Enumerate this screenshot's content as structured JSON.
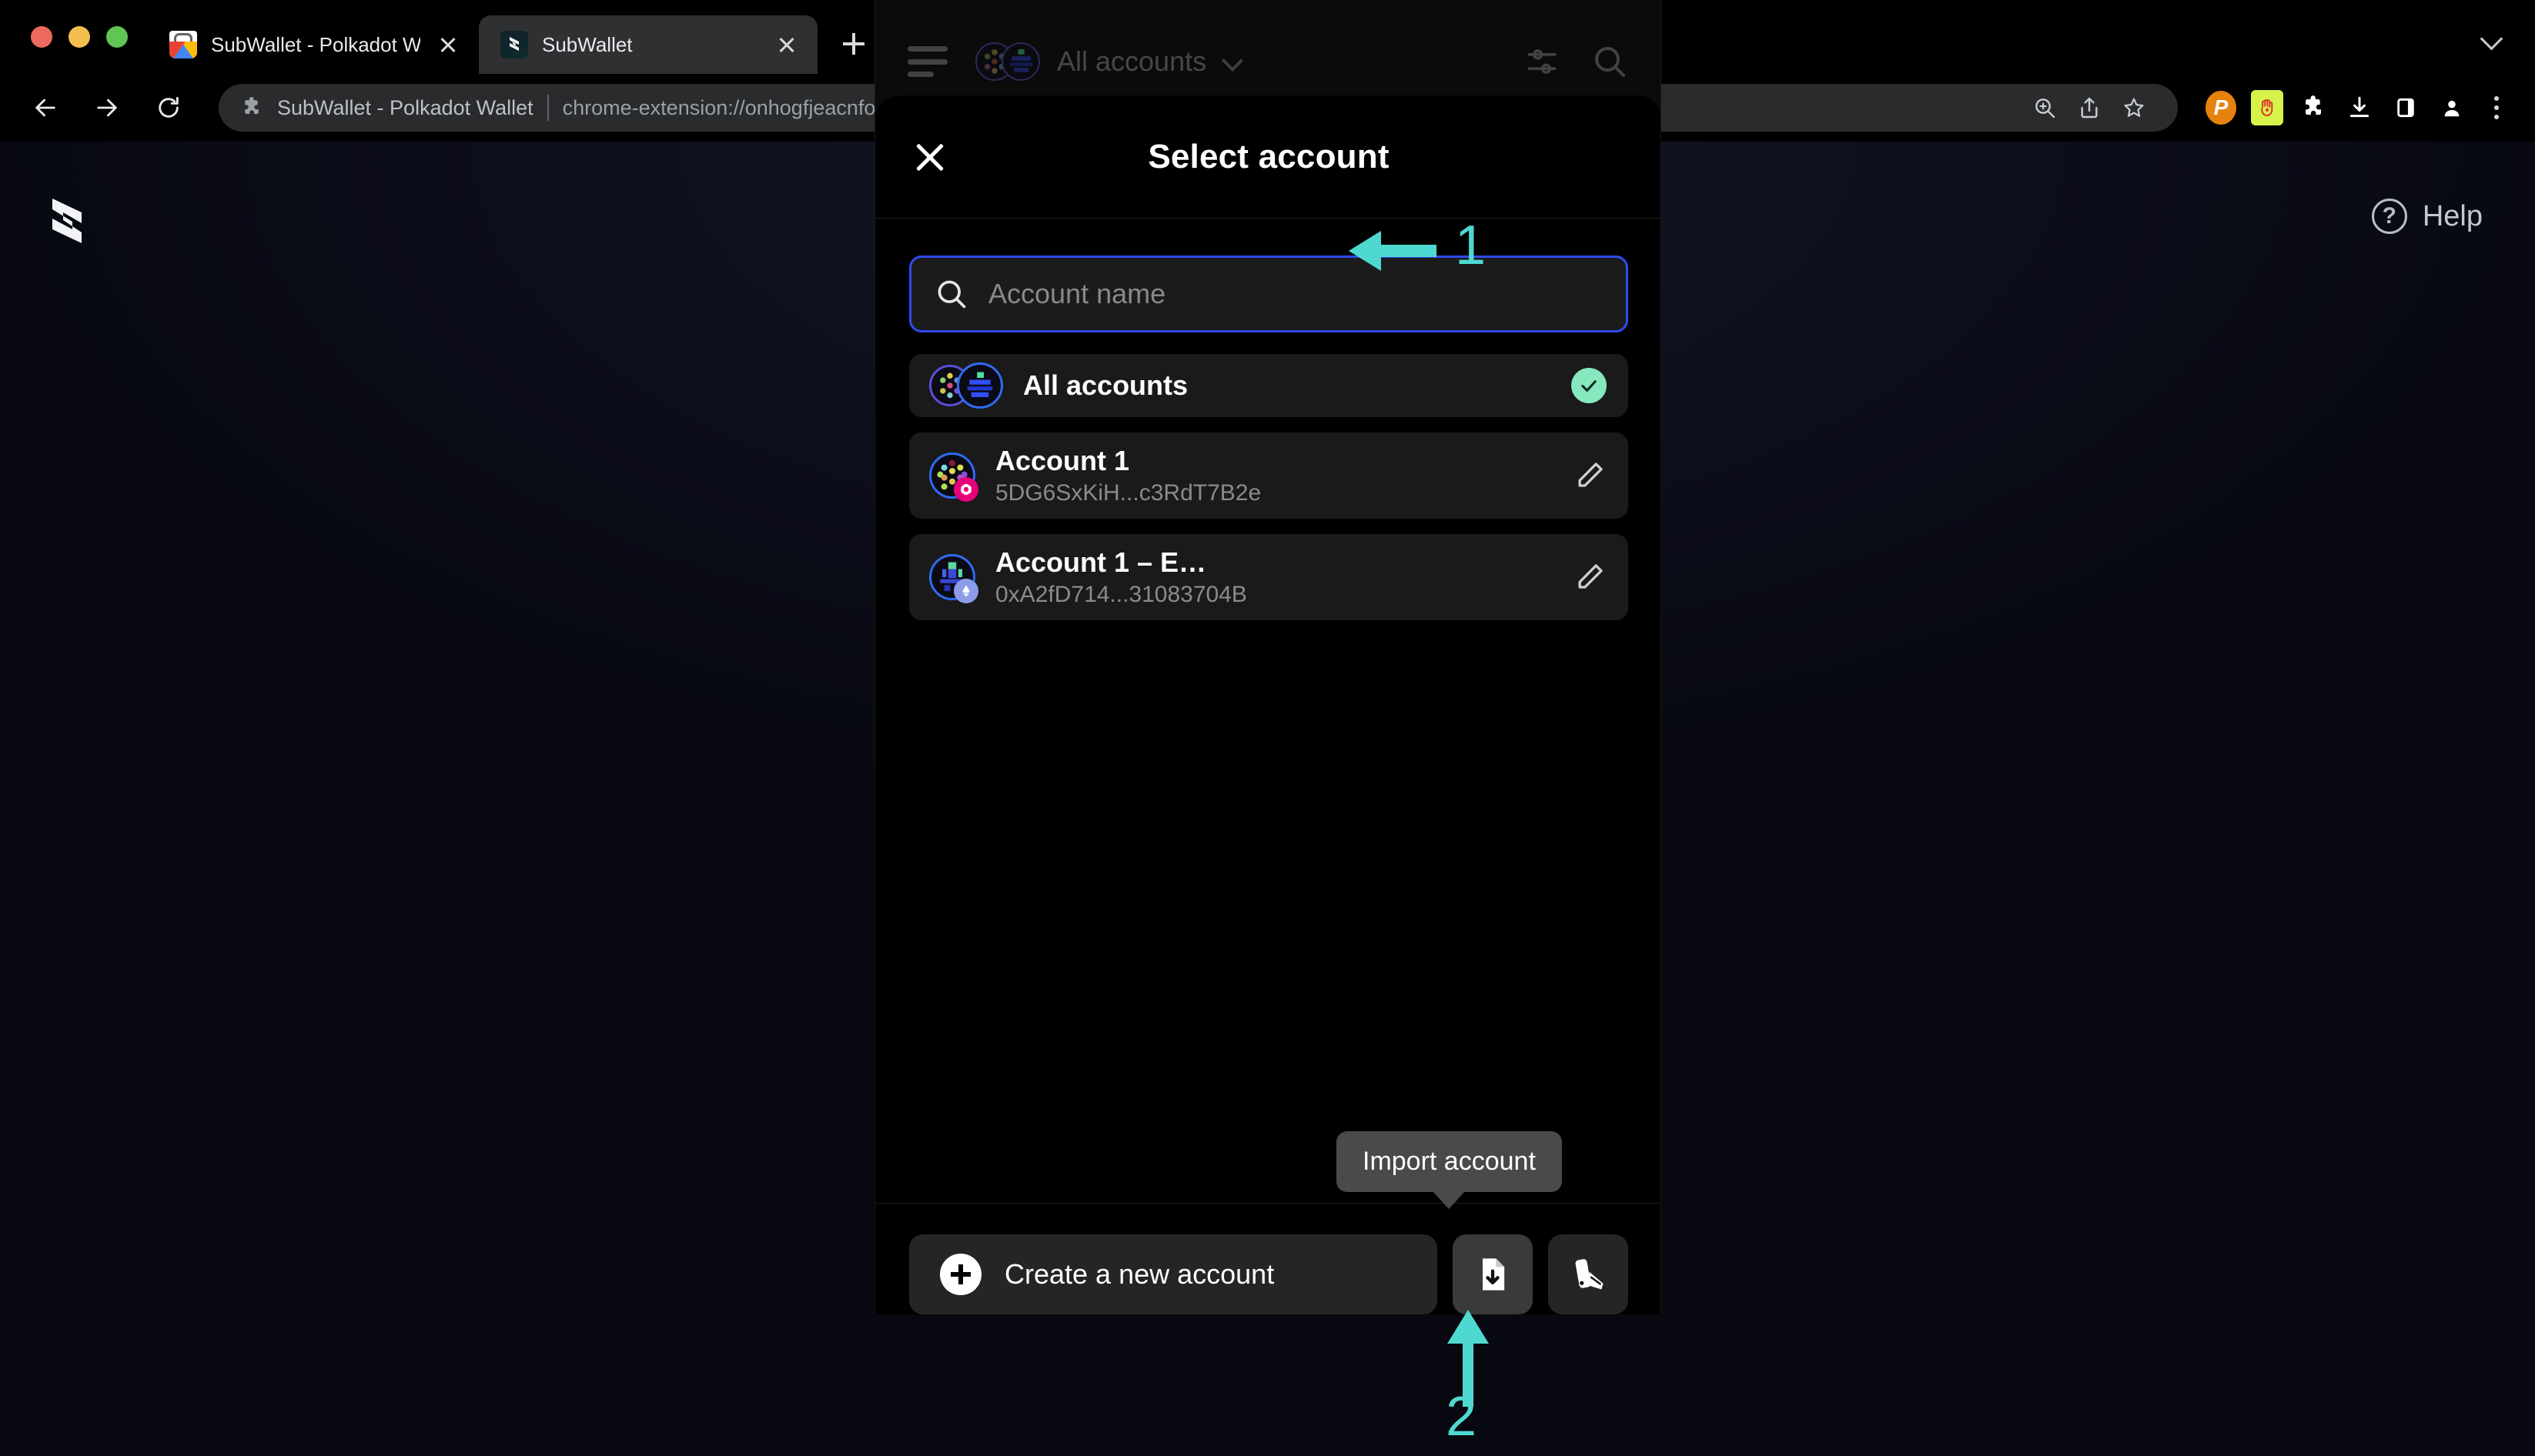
{
  "browser": {
    "tabs": [
      {
        "title": "SubWallet - Polkadot Wallet - C",
        "favicon": "chrome-webstore-icon",
        "active": false
      },
      {
        "title": "SubWallet",
        "favicon": "subwallet-icon",
        "active": true
      }
    ],
    "newtab_label": "+",
    "omnibox": {
      "extension_name": "SubWallet - Polkadot Wallet",
      "url": "chrome-extension://onhogfjeacnfoofkfgppdlbmlmnplgbn/index.html#/home/tokens"
    },
    "toolbar_icons": [
      "zoom-icon",
      "share-icon",
      "bookmark-star-icon",
      "polkadot-extension-icon",
      "talisman-extension-icon",
      "extensions-puzzle-icon",
      "downloads-icon",
      "side-panel-icon",
      "profile-avatar-icon",
      "chrome-menu-icon"
    ],
    "nav_icons": [
      "back-icon",
      "forward-icon",
      "reload-icon"
    ]
  },
  "page": {
    "logo": "subwallet-logo",
    "help": {
      "label": "Help",
      "icon": "question-mark-icon"
    }
  },
  "extension": {
    "header": {
      "menu_icon": "hamburger-menu-icon",
      "account_label": "All accounts",
      "chevron": "chevron-down-icon",
      "customize_icon": "sliders-icon",
      "search_icon": "search-icon"
    },
    "modal": {
      "title": "Select account",
      "close_icon": "close-icon",
      "search": {
        "placeholder": "Account name",
        "value": "",
        "icon": "search-icon",
        "focused": true,
        "focus_color": "#2f4bf2"
      },
      "accounts": [
        {
          "name": "All accounts",
          "address": "",
          "selected": true,
          "avatar": "all-accounts-avatar",
          "action_icon": "check-icon",
          "chain": ""
        },
        {
          "name": "Account 1",
          "address": "5DG6SxKiH...c3RdT7B2e",
          "selected": false,
          "avatar": "polkadot-identicon",
          "action_icon": "pencil-icon",
          "chain": "polkadot"
        },
        {
          "name": "Account 1 – E…",
          "address": "0xA2fD714...31083704B",
          "selected": false,
          "avatar": "ethereum-identicon",
          "action_icon": "pencil-icon",
          "chain": "ethereum"
        }
      ],
      "footer": {
        "create_label": "Create a new account",
        "create_icon": "plus-circle-icon",
        "import_icon": "import-file-icon",
        "attach_icon": "attach-account-icon",
        "tooltip": "Import account"
      }
    }
  },
  "annotations": {
    "accent_color": "#4FD8D0",
    "marker_1": "1",
    "marker_2": "2"
  }
}
